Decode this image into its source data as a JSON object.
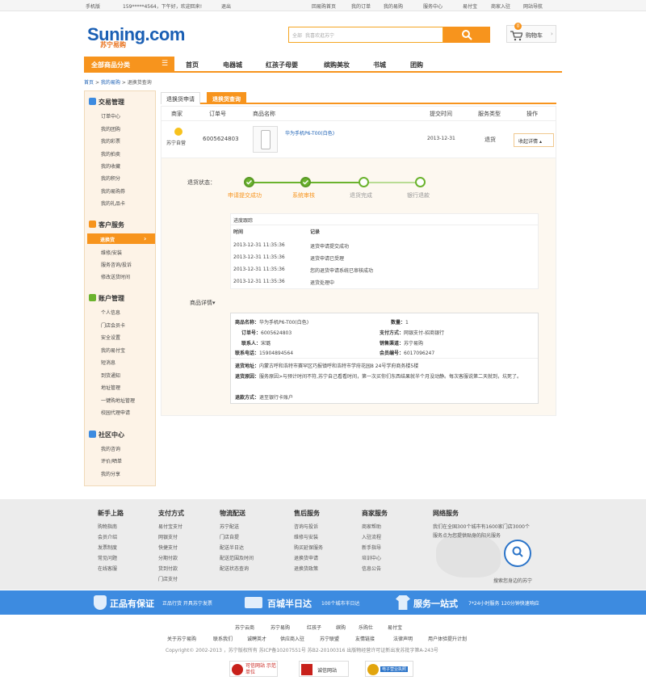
{
  "topbar": {
    "mobile": "手机版",
    "user": "159*****4564，下午好，欢迎回来!",
    "logout": "退出",
    "links": [
      "回易购首页",
      "我的订单",
      "我的易购",
      "服务中心",
      "易付宝",
      "商家入驻",
      "网站导航"
    ]
  },
  "header": {
    "logo": "Suning.com",
    "logo_sub": "苏宁易购",
    "search_category": "全部",
    "search_placeholder": "我喜欢逛苏宁",
    "cart_label": "购物车",
    "cart_count": "0"
  },
  "nav": {
    "all": "全部商品分类",
    "items": [
      "首页",
      "电器城",
      "红孩子母婴",
      "缤购美妆",
      "书城",
      "团购"
    ]
  },
  "breadcrumb": {
    "home": "首页",
    "my": "我的易购",
    "current": "退换货查询",
    "sep": ">"
  },
  "sidebar": {
    "sections": [
      {
        "title": "交易管理",
        "items": [
          "订单中心",
          "我的团购",
          "我的彩票",
          "我的拍卖",
          "我的收藏",
          "我的积分",
          "我的易购券",
          "我的礼品卡"
        ]
      },
      {
        "title": "客户服务",
        "items": [
          "退换货",
          "维修/安装",
          "服务咨询/投诉",
          "修改送货时间"
        ]
      },
      {
        "title": "账户管理",
        "items": [
          "个人信息",
          "门店会员卡",
          "安全设置",
          "我的易付宝",
          "短消息",
          "到货通知",
          "地址管理",
          "一键购地址管理",
          "校园代理申请"
        ]
      },
      {
        "title": "社区中心",
        "items": [
          "我的咨询",
          "评价/晒单",
          "我的分享"
        ]
      }
    ]
  },
  "tabs": [
    "退换货申请",
    "退换货查询"
  ],
  "table": {
    "headers": [
      "商家",
      "订单号",
      "商品名称",
      "提交时间",
      "服务类型",
      "操作"
    ],
    "row": {
      "seller": "苏宁自营",
      "order_no": "6005624803",
      "product": "华为手机P6-T00(白色)",
      "time": "2013-12-31",
      "service": "退货",
      "action": "收起详情"
    }
  },
  "status": {
    "label": "退货状态：",
    "steps": [
      "申请提交成功",
      "系统审核",
      "退货完成",
      "银行退款"
    ],
    "completed": 2
  },
  "tracking": {
    "title": "进度跟踪",
    "col_time": "时间",
    "col_record": "记录",
    "rows": [
      {
        "time": "2013-12-31 11:35:36",
        "record": "退货申请提交成功"
      },
      {
        "time": "2013-12-31 11:35:36",
        "record": "退货申请已受理"
      },
      {
        "time": "2013-12-31 11:35:36",
        "record": "您的退货申请系统已审核成功"
      },
      {
        "time": "2013-12-31 11:35:36",
        "record": "退货处理中"
      }
    ]
  },
  "product_detail": {
    "label": "商品详情",
    "name_k": "商品名称：",
    "name_v": "华为手机P6-T00(白色)",
    "qty_k": "数量：",
    "qty_v": "1",
    "order_k": "订单号：",
    "order_v": "6005624803",
    "pay_k": "支付方式：",
    "pay_v": "网银支付-招商银行",
    "contact_k": "联系人：",
    "contact_v": "宋璐",
    "channel_k": "销售渠道：",
    "channel_v": "苏宁易购",
    "phone_k": "联系电话：",
    "phone_v": "15904894564",
    "member_k": "会员编号：",
    "member_v": "6017096247",
    "addr_k": "退货地址：",
    "addr_v": "内蒙古呼和浩特市赛罕区巧报镇呼和浩特市学府花园8 24号学府商务楼5楼",
    "reason_k": "退货原因：",
    "reason_v": "服务原因>与预计时间不符,苏宁自己看看时间，第一次买你们东西结果就半个月没动静。每次客服说第二天就到，坑死了。",
    "refund_k": "退款方式：",
    "refund_v": "退至银行卡账户"
  },
  "footer": {
    "cols": [
      {
        "title": "新手上路",
        "items": [
          "购物指南",
          "会员介绍",
          "发票制度",
          "常见问题",
          "在线客服"
        ]
      },
      {
        "title": "支付方式",
        "items": [
          "易付宝支付",
          "网银支付",
          "快捷支付",
          "分期付款",
          "货到付款",
          "门店支付"
        ]
      },
      {
        "title": "物流配送",
        "items": [
          "苏宁配送",
          "门店自提",
          "配送半日达",
          "配送范围及时间",
          "配送状态查询"
        ]
      },
      {
        "title": "售后服务",
        "items": [
          "咨询与投诉",
          "维修与安装",
          "购买延保服务",
          "退换货申请",
          "退换货政策"
        ]
      },
      {
        "title": "商家服务",
        "items": [
          "商家帮助",
          "入驻流程",
          "新手指导",
          "培训中心",
          "信息公告"
        ]
      }
    ],
    "network_title": "网络服务",
    "network_text_1": "我们在全国300个城市有1600家门店3000个",
    "network_text_2": "服务点为您提供贴身的阳光服务",
    "network_link": "搜索您身边的苏宁"
  },
  "bluebar": {
    "a1": "正品有保证",
    "a2": "正品行货 开具苏宁发票",
    "b1": "百城半日达",
    "b2": "100个城市半日达",
    "c1": "服务一站式",
    "c2": "7*24小时服务 120分钟快速响应"
  },
  "links1": [
    "苏宁云商",
    "苏宁易购",
    "红孩子",
    "缤购",
    "乐购仕",
    "易付宝"
  ],
  "links2": [
    "关于苏宁易购",
    "联系我们",
    "诚聘英才",
    "供应商入驻",
    "苏宁联盟",
    "友情链接",
    "法律声明",
    "用户体验提升计划"
  ],
  "copyright": "Copyright© 2002-2013 ，苏宁版权所有 苏ICP备10207551号 苏B2-20100316 出版物经营许可证新出发苏批字第A-243号",
  "badges": [
    "可信网站 示范单位",
    "诚信网站",
    "电子营业执照"
  ],
  "colors": {
    "orange": "#f7941d",
    "blue": "#3d8be0",
    "green": "#6bb32e",
    "brand": "#1a5fb4"
  }
}
